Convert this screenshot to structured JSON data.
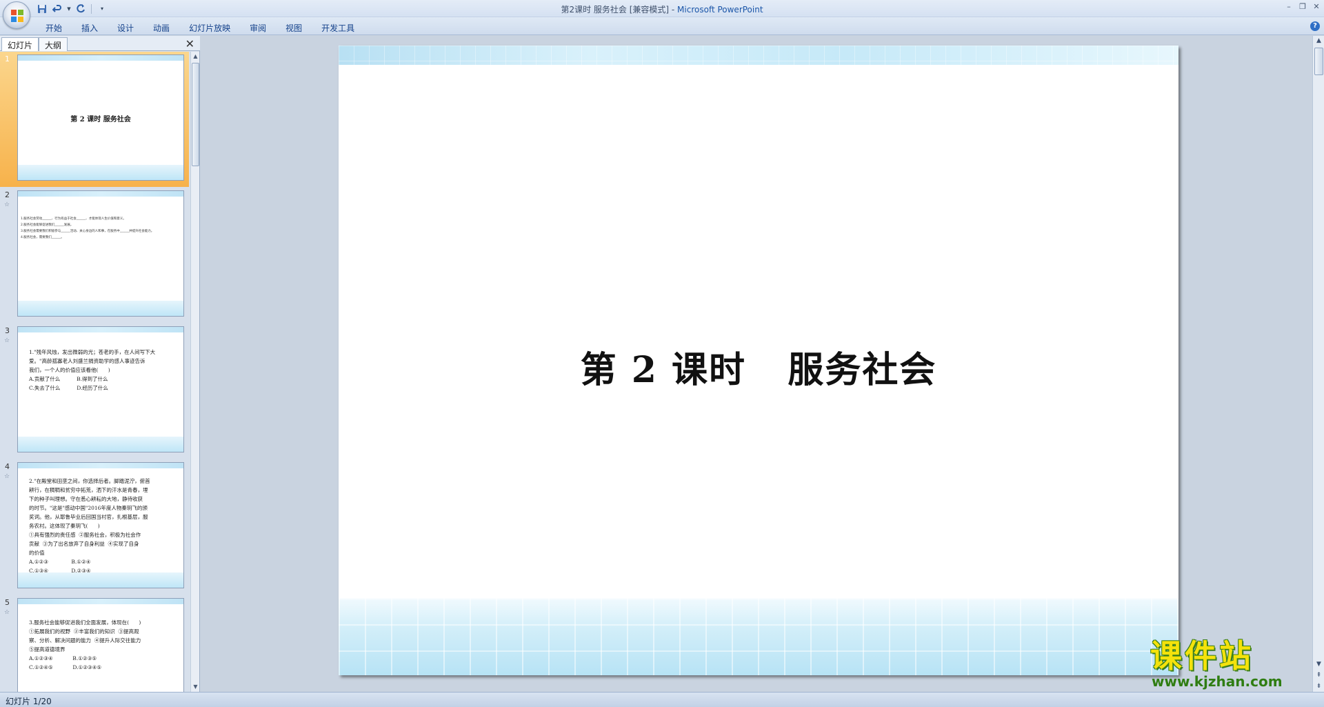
{
  "window": {
    "title_doc": "第2课时 服务社会 [兼容模式]",
    "title_sep": " - ",
    "title_app": "Microsoft PowerPoint"
  },
  "ribbon": {
    "tabs": [
      "开始",
      "插入",
      "设计",
      "动画",
      "幻灯片放映",
      "审阅",
      "视图",
      "开发工具"
    ]
  },
  "left_pane": {
    "tabs": [
      "幻灯片",
      "大纲"
    ],
    "close": "✕"
  },
  "thumbnails": [
    {
      "num": "1",
      "title": "第 2 课时   服务社会"
    },
    {
      "num": "2",
      "text": "1.服务社会劳动______、行为有益于社会______、才能体现人生价值和意义。\n2.服务社会能够促进我们______发展。\n3.服务社会需要我们积极参与______活动、关心身边的人和事，在服务中______并提升社会能力。\n4.服务社会，需要我们______。"
    },
    {
      "num": "3",
      "text": "1.\"残年风烛，发出微弱的光；苍老的手，在人间写下大\n爱。\"高龄孤寡老人刘盛兰捐资助学的感人事迹告诉\n我们，一个人的价值应该看他(      )\nA.贡献了什么          B.得到了什么\nC.失去了什么          D.经历了什么"
    },
    {
      "num": "4",
      "text": "2.\"在殿堂和田垄之间，你选择后者。脚踏泥泞，俯首\n耕行，在稠稠和贫穷中拓荒，洒下的汗水是青春，埋\n下的种子叫理想。守在悉心耕耘的大地，静待收获\n的时节。\"这是\"感动中国\"2016年度人物秦玥飞的颁\n奖词。他，从耶鲁毕业后回国当村官，扎根基层，服\n务农村。这体现了秦玥飞(      )\n①具有强烈的责任感  ②服务社会，积极为社会作\n贡献  ③为了出名放弃了自身利益  ④实现了自身\n的价值\nA.①②③              B.①②④\nC.①③④              D.②③④"
    },
    {
      "num": "5",
      "text": "3.服务社会能够促进我们全面发展，体现在(      )\n①拓展我们的视野  ②丰富我们的知识  ③提高观\n察、分析、解决问题的能力  ④提升人际交往能力\n⑤提高道德境界\nA.①②③④            B.①②③⑤\nC.①②④⑤            D.①②③④⑤"
    }
  ],
  "slide": {
    "title": "第 2 课时   服务社会"
  },
  "status": {
    "slide_indicator": "幻灯片 1/20"
  },
  "watermark": {
    "main": "课件站",
    "url": "www.kjzhan.com"
  },
  "colors": {
    "accent": "#15428b",
    "selected_thumb": "#f7b24b",
    "watermark_yellow": "#f4e20b",
    "watermark_green": "#2f7d12"
  }
}
